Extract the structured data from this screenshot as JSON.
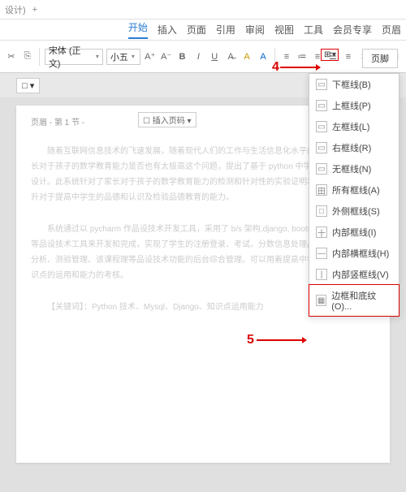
{
  "topbar": {
    "tab": "设计)",
    "plus": "+"
  },
  "menu": {
    "items": [
      "开始",
      "插入",
      "页面",
      "引用",
      "审阅",
      "视图",
      "工具",
      "会员专享",
      "页眉"
    ]
  },
  "toolbar": {
    "font": "宋体 (正文)",
    "size": "小五",
    "page_btn": "页脚"
  },
  "ruler": {
    "outline": "□ ▾",
    "page_info": "页眉 - 第 1 节 -",
    "insert": "☐ 插入页码 ▾"
  },
  "body": {
    "p1": "随着互联网信息技术的飞速发展，随着现代人们的工作与生活信息化水平的不断发展，对家长对于孩子的数学教育能力是否也有太极高这个问题，提出了基于 python 中学生品德的系统的设计。此系统针对了家长对于孩子的数学教育能力的检测和针对性的实验证明本系统确确实实提升对于提高中学生的品德和认识及检验品德教育的能力。",
    "p2": "系统通过以 pycharm 作品设技术开发工具，采用了 b/s 架构,django, bootstrap 框架,python 等品设技术工具来开发和完成，实现了学生的注册登录、考试、分数信息处理品设知识点的学情分析、测验管理、该课程理等品设技术功能的后台综合管理。可以用着提高中学生的品设学习知识点的运用和能力的考核。",
    "p3": "【关键词】：Python 技术、Mysql、Django、知识点运用能力"
  },
  "border_menu": {
    "items": [
      {
        "icon": "▭",
        "label": "下框线(B)"
      },
      {
        "icon": "▭",
        "label": "上框线(P)"
      },
      {
        "icon": "▭",
        "label": "左框线(L)"
      },
      {
        "icon": "▭",
        "label": "右框线(R)"
      },
      {
        "icon": "▭",
        "label": "无框线(N)"
      },
      {
        "icon": "田",
        "label": "所有框线(A)"
      },
      {
        "icon": "□",
        "label": "外侧框线(S)"
      },
      {
        "icon": "十",
        "label": "内部框线(I)"
      },
      {
        "icon": "—",
        "label": "内部横框线(H)"
      },
      {
        "icon": "|",
        "label": "内部竖框线(V)"
      },
      {
        "icon": "▦",
        "label": "边框和底纹(O)..."
      }
    ]
  },
  "markers": {
    "m4": "4",
    "m5": "5"
  }
}
